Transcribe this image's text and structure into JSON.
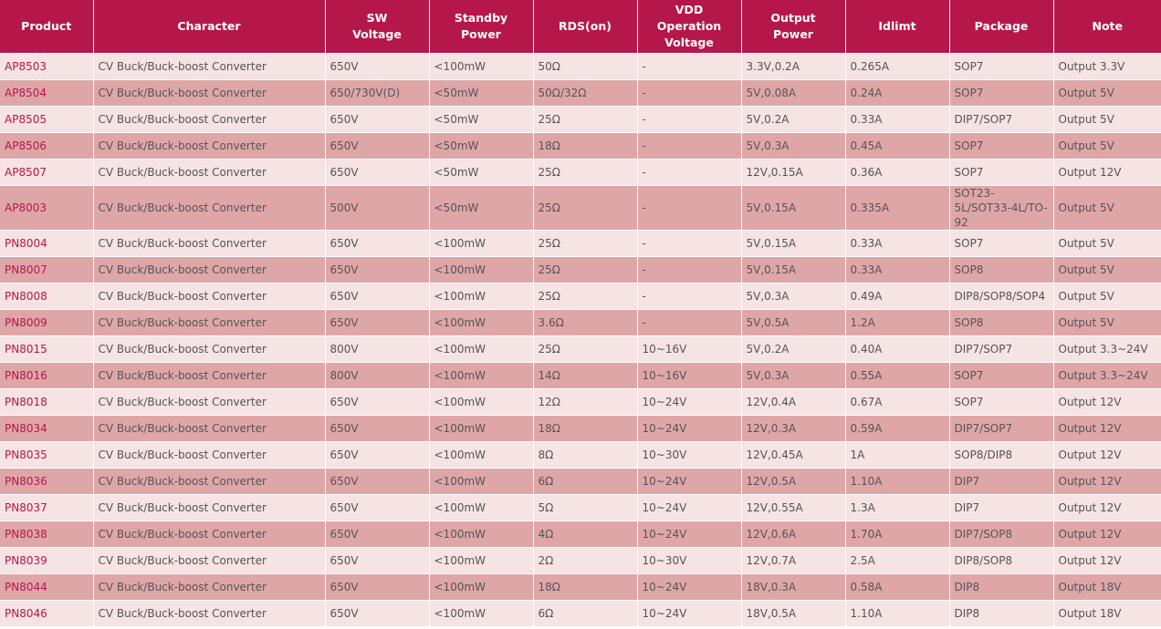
{
  "headers": {
    "product": "Product",
    "character": "Character",
    "sw_voltage": [
      "SW",
      "Voltage"
    ],
    "standby_power": [
      "Standby",
      "Power"
    ],
    "rds_on": "RDS(on)",
    "vdd": [
      "VDD",
      "Operation",
      "Voltage"
    ],
    "output_power": [
      "Output",
      "Power"
    ],
    "idlimt": "Idlimt",
    "package": "Package",
    "note": "Note"
  },
  "rows": [
    {
      "product": "AP8503",
      "character": "CV Buck/Buck-boost Converter",
      "sw": "650V",
      "standby": "<100mW",
      "rds": "50Ω",
      "vdd": "-",
      "output": "3.3V,0.2A",
      "idlimt": "0.265A",
      "package": "SOP7",
      "note": "Output 3.3V"
    },
    {
      "product": "AP8504",
      "character": "CV Buck/Buck-boost Converter",
      "sw": "650/730V(D)",
      "standby": "<50mW",
      "rds": "50Ω/32Ω",
      "vdd": "-",
      "output": "5V,0.08A",
      "idlimt": "0.24A",
      "package": "SOP7",
      "note": "Output 5V"
    },
    {
      "product": "AP8505",
      "character": "CV Buck/Buck-boost Converter",
      "sw": "650V",
      "standby": "<50mW",
      "rds": "25Ω",
      "vdd": "-",
      "output": "5V,0.2A",
      "idlimt": "0.33A",
      "package": "DIP7/SOP7",
      "note": "Output 5V"
    },
    {
      "product": "AP8506",
      "character": "CV Buck/Buck-boost Converter",
      "sw": "650V",
      "standby": "<50mW",
      "rds": "18Ω",
      "vdd": "-",
      "output": "5V,0.3A",
      "idlimt": "0.45A",
      "package": "SOP7",
      "note": "Output 5V"
    },
    {
      "product": "AP8507",
      "character": "CV Buck/Buck-boost Converter",
      "sw": "650V",
      "standby": "<50mW",
      "rds": "25Ω",
      "vdd": "-",
      "output": "12V,0.15A",
      "idlimt": "0.36A",
      "package": "SOP7",
      "note": "Output 12V"
    },
    {
      "product": "AP8003",
      "character": "CV Buck/Buck-boost Converter",
      "sw": "500V",
      "standby": "<50mW",
      "rds": "25Ω",
      "vdd": "-",
      "output": "5V,0.15A",
      "idlimt": "0.335A",
      "package": "SOT23-5L/SOT33-4L/TO-92",
      "note": "Output 5V",
      "tall": true
    },
    {
      "product": "PN8004",
      "character": "CV Buck/Buck-boost Converter",
      "sw": "650V",
      "standby": "<100mW",
      "rds": "25Ω",
      "vdd": "-",
      "output": "5V,0.15A",
      "idlimt": "0.33A",
      "package": "SOP7",
      "note": "Output 5V"
    },
    {
      "product": "PN8007",
      "character": "CV Buck/Buck-boost Converter",
      "sw": "650V",
      "standby": "<100mW",
      "rds": "25Ω",
      "vdd": "-",
      "output": "5V,0.15A",
      "idlimt": "0.33A",
      "package": "SOP8",
      "note": "Output 5V"
    },
    {
      "product": "PN8008",
      "character": "CV Buck/Buck-boost Converter",
      "sw": "650V",
      "standby": "<100mW",
      "rds": "25Ω",
      "vdd": "-",
      "output": "5V,0.3A",
      "idlimt": "0.49A",
      "package": "DIP8/SOP8/SOP4",
      "note": "Output 5V"
    },
    {
      "product": "PN8009",
      "character": "CV Buck/Buck-boost Converter",
      "sw": "650V",
      "standby": "<100mW",
      "rds": "3.6Ω",
      "vdd": "-",
      "output": "5V,0.5A",
      "idlimt": "1.2A",
      "package": "SOP8",
      "note": "Output 5V"
    },
    {
      "product": "PN8015",
      "character": "CV Buck/Buck-boost Converter",
      "sw": "800V",
      "standby": "<100mW",
      "rds": "25Ω",
      "vdd": "10~16V",
      "output": "5V,0.2A",
      "idlimt": "0.40A",
      "package": "DIP7/SOP7",
      "note": "Output 3.3~24V"
    },
    {
      "product": "PN8016",
      "character": "CV Buck/Buck-boost Converter",
      "sw": "800V",
      "standby": "<100mW",
      "rds": "14Ω",
      "vdd": "10~16V",
      "output": "5V,0.3A",
      "idlimt": "0.55A",
      "package": "SOP7",
      "note": "Output 3.3~24V"
    },
    {
      "product": "PN8018",
      "character": "CV Buck/Buck-boost Converter",
      "sw": "650V",
      "standby": "<100mW",
      "rds": "12Ω",
      "vdd": "10~24V",
      "output": "12V,0.4A",
      "idlimt": "0.67A",
      "package": "SOP7",
      "note": "Output 12V"
    },
    {
      "product": "PN8034",
      "character": "CV Buck/Buck-boost Converter",
      "sw": "650V",
      "standby": "<100mW",
      "rds": "18Ω",
      "vdd": "10~24V",
      "output": "12V,0.3A",
      "idlimt": "0.59A",
      "package": "DIP7/SOP7",
      "note": "Output 12V"
    },
    {
      "product": "PN8035",
      "character": "CV Buck/Buck-boost Converter",
      "sw": "650V",
      "standby": "<100mW",
      "rds": "8Ω",
      "vdd": "10~30V",
      "output": "12V,0.45A",
      "idlimt": "1A",
      "package": "SOP8/DIP8",
      "note": "Output 12V"
    },
    {
      "product": "PN8036",
      "character": "CV Buck/Buck-boost Converter",
      "sw": "650V",
      "standby": "<100mW",
      "rds": "6Ω",
      "vdd": "10~24V",
      "output": "12V,0.5A",
      "idlimt": "1.10A",
      "package": "DIP7",
      "note": "Output 12V"
    },
    {
      "product": "PN8037",
      "character": "CV Buck/Buck-boost Converter",
      "sw": "650V",
      "standby": "<100mW",
      "rds": "5Ω",
      "vdd": "10~24V",
      "output": "12V,0.55A",
      "idlimt": "1.3A",
      "package": "DIP7",
      "note": "Output 12V"
    },
    {
      "product": "PN8038",
      "character": "CV Buck/Buck-boost Converter",
      "sw": "650V",
      "standby": "<100mW",
      "rds": "4Ω",
      "vdd": "10~24V",
      "output": "12V,0.6A",
      "idlimt": "1.70A",
      "package": "DIP7/SOP8",
      "note": "Output 12V"
    },
    {
      "product": "PN8039",
      "character": "CV Buck/Buck-boost Converter",
      "sw": "650V",
      "standby": "<100mW",
      "rds": "2Ω",
      "vdd": "10~30V",
      "output": "12V,0.7A",
      "idlimt": "2.5A",
      "package": "DIP8/SOP8",
      "note": "Output 12V"
    },
    {
      "product": "PN8044",
      "character": "CV Buck/Buck-boost Converter",
      "sw": "650V",
      "standby": "<100mW",
      "rds": "18Ω",
      "vdd": "10~24V",
      "output": "18V,0.3A",
      "idlimt": "0.58A",
      "package": "DIP8",
      "note": "Output 18V"
    },
    {
      "product": "PN8046",
      "character": "CV Buck/Buck-boost Converter",
      "sw": "650V",
      "standby": "<100mW",
      "rds": "6Ω",
      "vdd": "10~24V",
      "output": "18V,0.5A",
      "idlimt": "1.10A",
      "package": "DIP8",
      "note": "Output 18V"
    }
  ]
}
